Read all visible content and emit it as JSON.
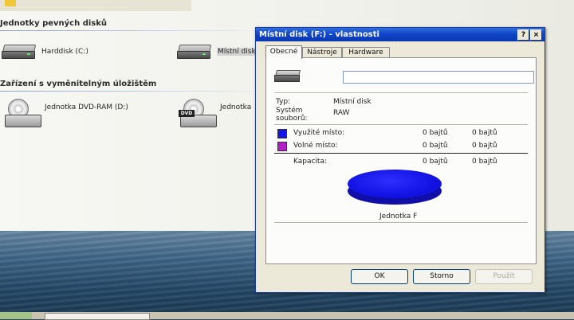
{
  "explorer": {
    "sections": [
      {
        "title": "Jednotky pevných disků"
      },
      {
        "title": "Zařízení s vyměnitelným úložištěm"
      }
    ],
    "drives": [
      {
        "label": "Harddisk (C:)",
        "icon": "hdd-icon"
      },
      {
        "label": "Místní disk",
        "icon": "hdd-icon"
      },
      {
        "label": "Jednotka DVD-RAM (D:)",
        "icon": "dvd-icon"
      },
      {
        "label": "Jednotka",
        "icon": "dvd-icon"
      }
    ],
    "dvd_tag": "DVD"
  },
  "dialog": {
    "title": "Místní disk (F:) - vlastnosti",
    "help_btn": "?",
    "close_btn": "×",
    "tabs": [
      {
        "label": "Obecné",
        "active": true
      },
      {
        "label": "Nástroje",
        "active": false
      },
      {
        "label": "Hardware",
        "active": false
      }
    ],
    "name_value": "",
    "type_label": "Typ:",
    "type_value": "Místní disk",
    "fs_label": "Systém souborů:",
    "fs_value": "RAW",
    "used_label": "Využité místo:",
    "used_bytes": "0 bajtů",
    "used_size": "0 bajtů",
    "used_color": "#1414e6",
    "free_label": "Volné místo:",
    "free_bytes": "0 bajtů",
    "free_size": "0 bajtů",
    "free_color": "#b020c8",
    "capacity_label": "Kapacita:",
    "capacity_bytes": "0 bajtů",
    "capacity_size": "0 bajtů",
    "drive_label": "Jednotka F",
    "buttons": {
      "ok": "OK",
      "cancel": "Storno",
      "apply": "Použít"
    }
  }
}
